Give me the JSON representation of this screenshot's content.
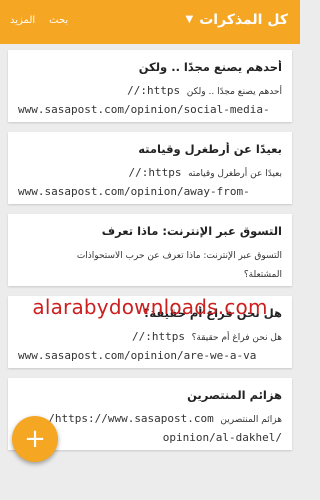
{
  "app_bar": {
    "title": "كل المذكرات",
    "chevron_icon": "chevron-down-icon",
    "search_label": "بحث",
    "more_label": "المزيد",
    "color": "#f5a623"
  },
  "notes": [
    {
      "title": "أحدهم يصنع مجدًا .. ولكن",
      "line1_url": "https://",
      "line1_text": "أحدهم يصنع مجدًا .. ولكن",
      "line2": "www.sasapost.com/opinion/social-media-"
    },
    {
      "title": "بعيدًا عن أرطغرل وقيامته",
      "line1_url": "https://",
      "line1_text": "بعيدًا عن أرطغرل وقيامته",
      "line2": "www.sasapost.com/opinion/away-from-"
    },
    {
      "title": "التسوق عبر الإنترنت: ماذا تعرف",
      "line1_url": "",
      "line1_text": "التسوق عبر الإنترنت: ماذا تعرف عن حرب الاستحواذات",
      "line2": "المشتعلة؟"
    },
    {
      "title": "هل نحن فراغ أم حقيقة؟",
      "line1_url": "https://",
      "line1_text": "هل نحن فراغ أم حقيقة؟",
      "line2": "www.sasapost.com/opinion/are-we-a-va"
    },
    {
      "title": "هزائم المنتصرين",
      "line1_url": "https://www.sasapost.com/",
      "line1_text": "هزائم المنتصرين",
      "line2": "/opinion/al-dakhel"
    }
  ],
  "watermark": "alarabydownloads.com",
  "fab": {
    "label": "+",
    "icon": "plus-icon"
  }
}
